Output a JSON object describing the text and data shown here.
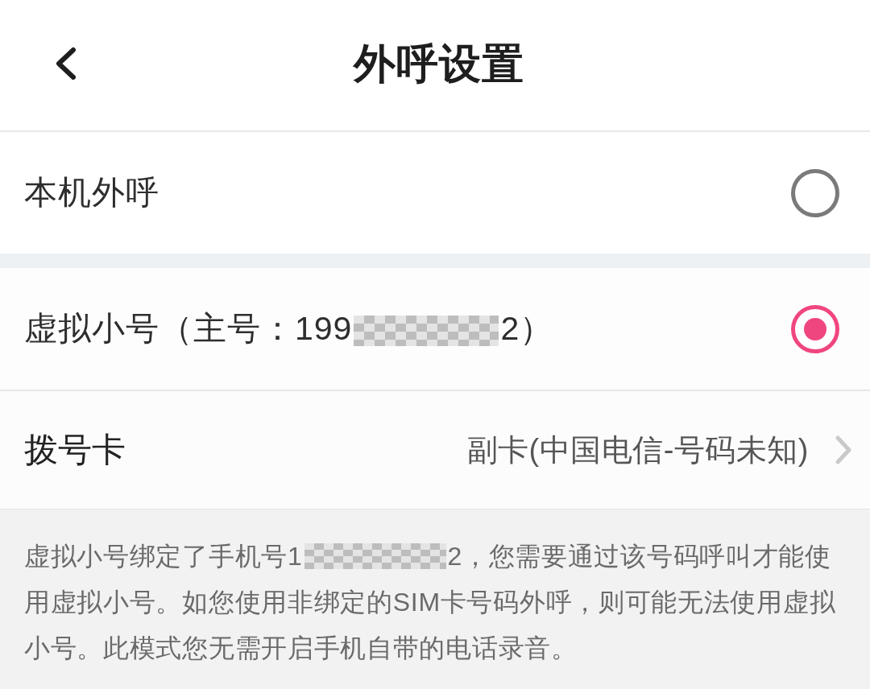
{
  "header": {
    "title": "外呼设置"
  },
  "call_modes": [
    {
      "label_parts": [
        "本机外呼"
      ],
      "selected": false
    },
    {
      "label_parts": [
        "虚拟小号（主号：199",
        "2）"
      ],
      "selected": true
    }
  ],
  "dial_card": {
    "label": "拨号卡",
    "value": "副卡(中国电信-号码未知)"
  },
  "note": {
    "text_parts": [
      "虚拟小号绑定了手机号1",
      "2，您需要通过该号码呼叫才能使用虚拟小号。如您使用非绑定的SIM卡号码外呼，则可能无法使用虚拟小号。此模式您无需开启手机自带的电话录音。"
    ]
  }
}
